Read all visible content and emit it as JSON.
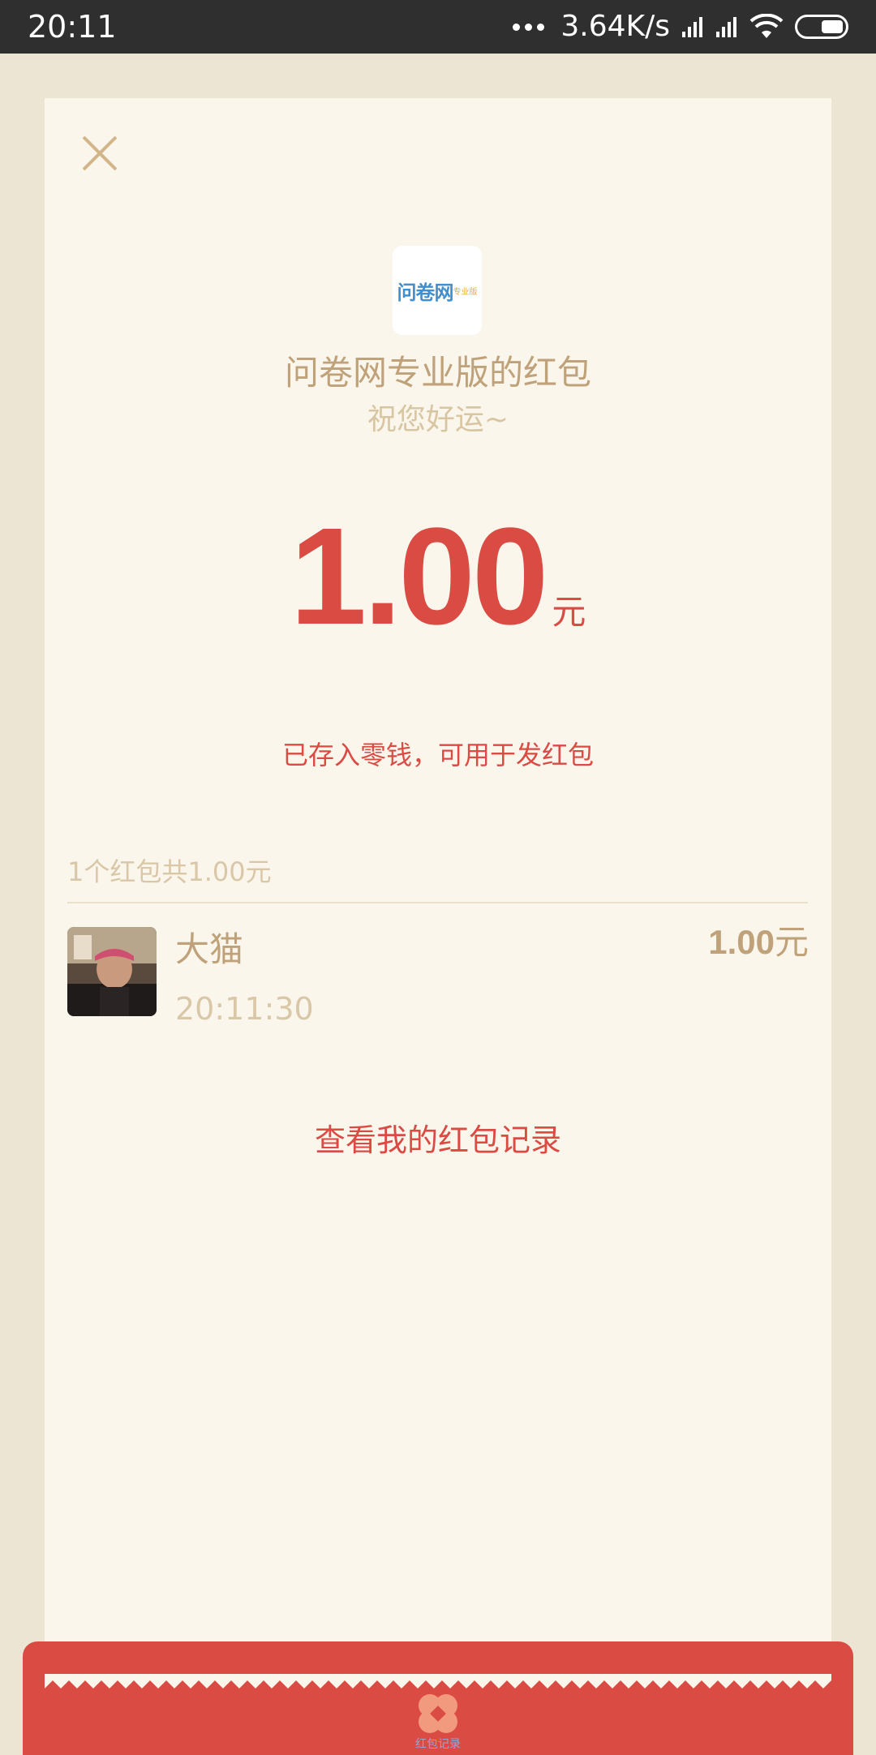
{
  "status_bar": {
    "time": "20:11",
    "net_speed": "3.64K/s"
  },
  "envelope": {
    "logo_text": "问卷网",
    "logo_sup": "专业版",
    "sender_title": "问卷网专业版的红包",
    "wish": "祝您好运~",
    "amount_value": "1.00",
    "amount_unit": "元",
    "stored_note": "已存入零钱，可用于发红包",
    "summary": "1个红包共1.00元"
  },
  "receiver": {
    "name": "大猫",
    "time": "20:11:30",
    "amount_value": "1.00",
    "amount_unit": "元"
  },
  "records_link": "查看我的红包记录",
  "bottom": {
    "label": "红包记录"
  },
  "colors": {
    "accent_red": "#d94b43",
    "gold_text": "#c0a27a",
    "card_bg": "#faf6ec",
    "page_bg": "#ede5d3"
  }
}
